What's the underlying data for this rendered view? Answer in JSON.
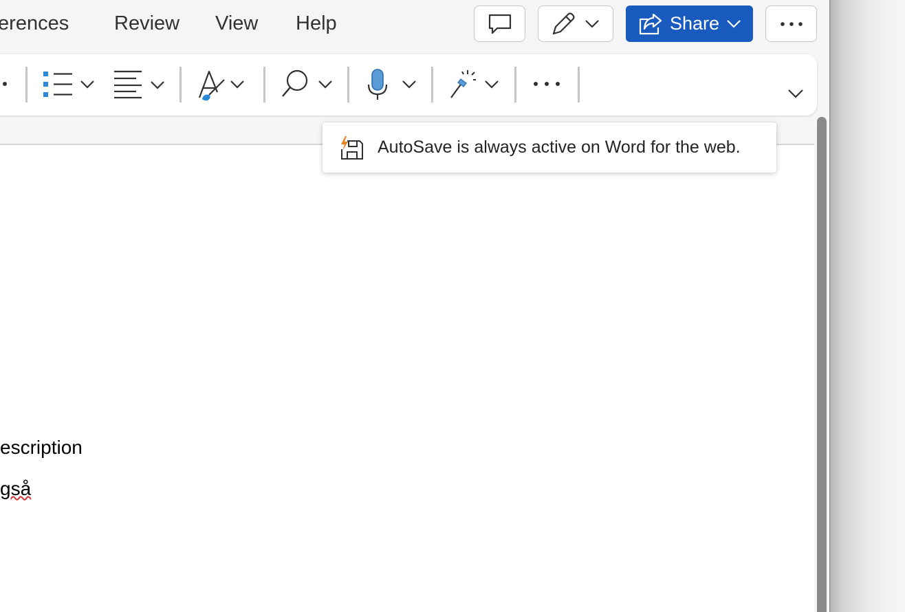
{
  "menu_tabs": [
    "ferences",
    "Review",
    "View",
    "Help"
  ],
  "header_buttons": {
    "comments_icon": "comment-icon",
    "editing_icon": "pencil-icon",
    "share_label": "Share",
    "more_icon": "ellipsis-icon"
  },
  "ribbon": {
    "items": [
      {
        "name": "bullets",
        "icon": "bullet-list-icon"
      },
      {
        "name": "align",
        "icon": "paragraph-align-icon"
      },
      {
        "name": "styles",
        "icon": "text-styles-icon"
      },
      {
        "name": "find",
        "icon": "search-icon"
      },
      {
        "name": "dictate",
        "icon": "microphone-icon"
      },
      {
        "name": "designer",
        "icon": "magic-wand-icon"
      },
      {
        "name": "more",
        "icon": "ellipsis-icon"
      }
    ],
    "expand_icon": "chevron-down-icon"
  },
  "tooltip": {
    "text": "AutoSave is always active on Word for the web.",
    "icon": "autosave-icon"
  },
  "document": {
    "lines": [
      "escription",
      "gså"
    ]
  },
  "colors": {
    "accent": "#185abd",
    "mic_blue": "#4a90d9",
    "autosave_orange": "#e8821c"
  }
}
